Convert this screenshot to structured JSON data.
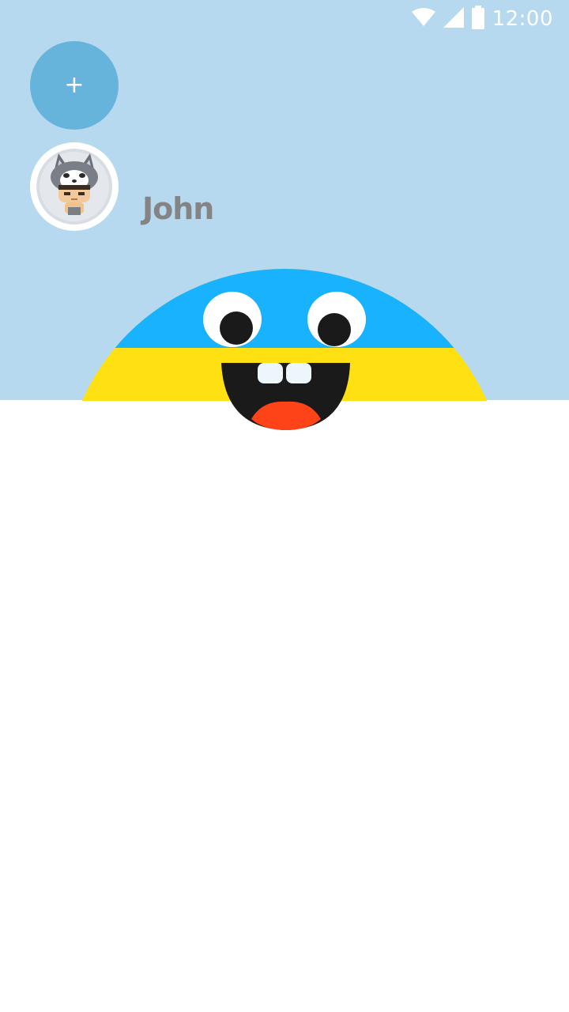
{
  "status_bar": {
    "time": "12:00",
    "icons": [
      "wifi-icon",
      "signal-icon",
      "battery-icon"
    ]
  },
  "profile": {
    "add_label": "+",
    "name": "John"
  },
  "colors": {
    "header_bg": "#b7d9f0",
    "add_button": "#66b3dc",
    "mascot_blue": "#19b2ff",
    "mascot_yellow": "#ffe012",
    "mascot_tongue": "#ff4318"
  }
}
